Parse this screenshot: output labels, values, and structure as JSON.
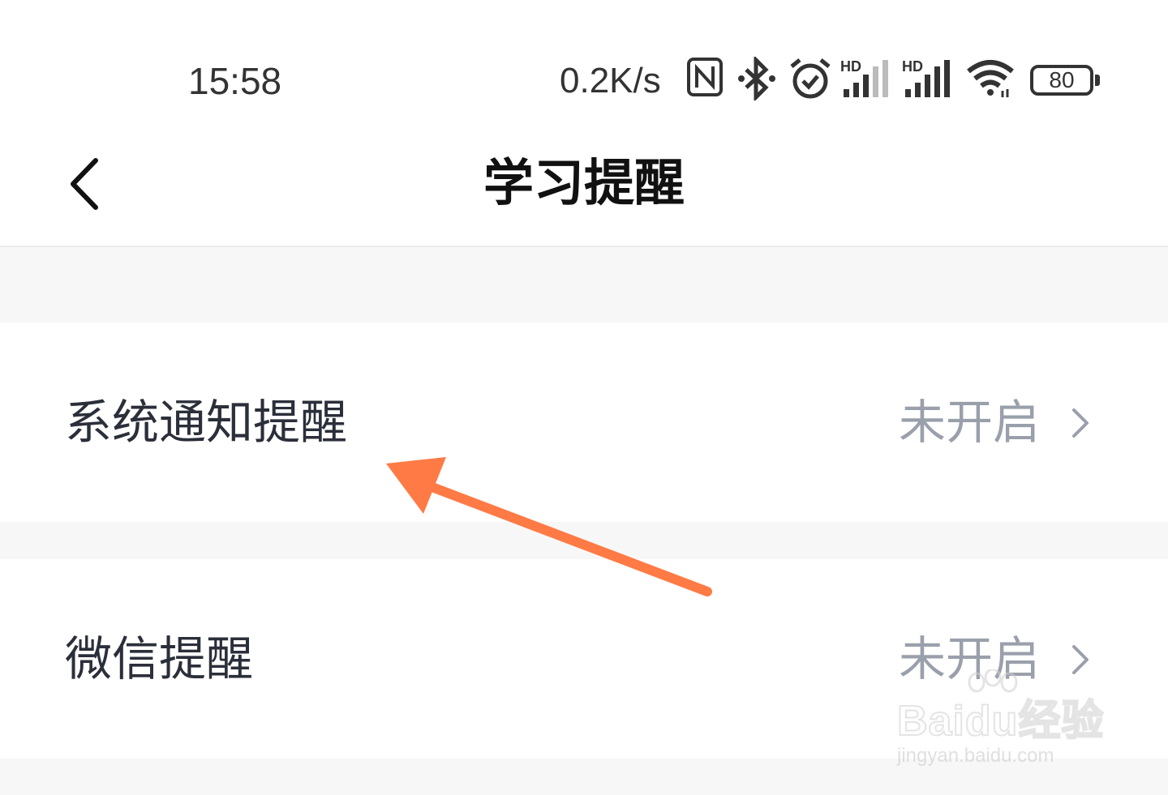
{
  "status_bar": {
    "time": "15:58",
    "net_speed": "0.2K/s",
    "battery": "80",
    "icons": [
      "nfc-icon",
      "bluetooth-icon",
      "alarm-icon",
      "signal-hd-icon",
      "signal-hd-icon",
      "wifi-icon",
      "battery-icon"
    ]
  },
  "nav": {
    "title": "学习提醒",
    "back_icon": "chevron-left-icon"
  },
  "settings": [
    {
      "label": "系统通知提醒",
      "value": "未开启"
    },
    {
      "label": "微信提醒",
      "value": "未开启"
    }
  ],
  "watermark": {
    "logo_text": "Baidu经验",
    "url": "jingyan.baidu.com"
  },
  "colors": {
    "annotation_arrow": "#ff7a45",
    "label_text": "#2b2f3a",
    "value_text": "#9aa0ab",
    "page_bg": "#f7f7f7"
  }
}
